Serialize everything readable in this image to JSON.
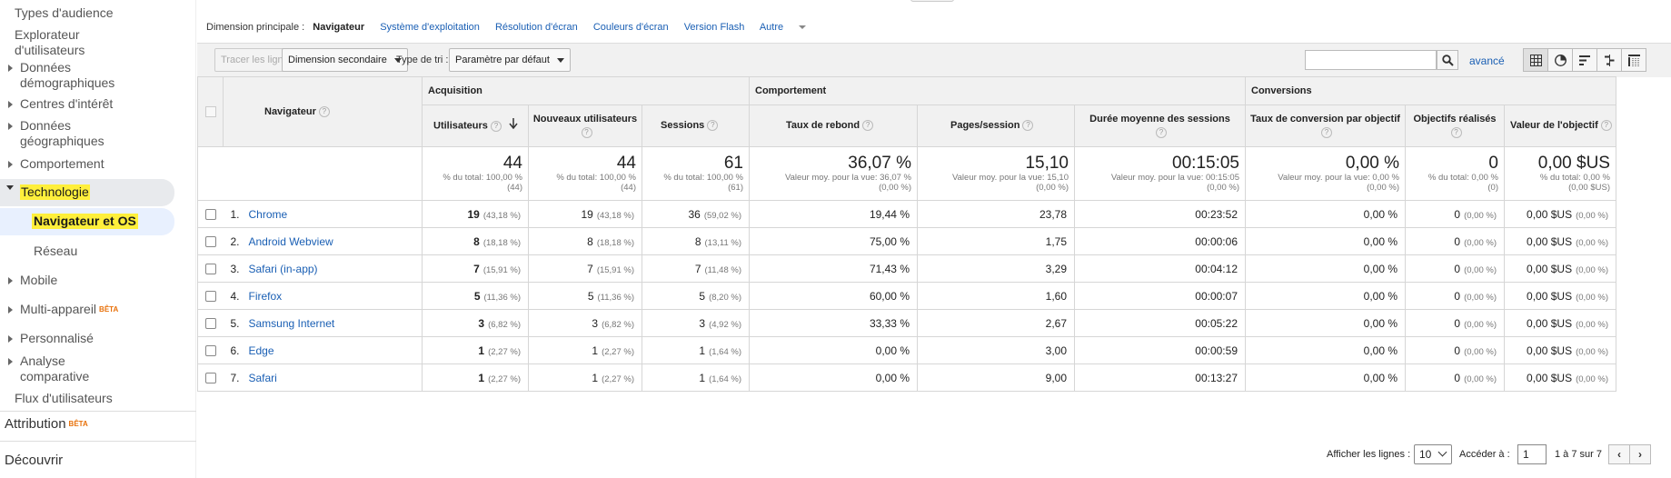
{
  "sidebar": {
    "items": [
      {
        "label": "Types d'audience"
      },
      {
        "label": "Explorateur d'utilisateurs"
      },
      {
        "label": "Données démographiques"
      },
      {
        "label": "Centres d'intérêt"
      },
      {
        "label": "Données géographiques"
      },
      {
        "label": "Comportement"
      },
      {
        "label": "Technologie"
      },
      {
        "label": "Navigateur et OS"
      },
      {
        "label": "Réseau"
      },
      {
        "label": "Mobile"
      },
      {
        "label": "Multi-appareil"
      },
      {
        "label": "Personnalisé"
      },
      {
        "label": "Analyse comparative"
      },
      {
        "label": "Flux d'utilisateurs"
      }
    ],
    "beta_label": "BÊTA",
    "attribution": "Attribution",
    "decouvrir": "Découvrir"
  },
  "dimension_bar": {
    "label": "Dimension principale :",
    "current": "Navigateur",
    "options": [
      "Système d'exploitation",
      "Résolution d'écran",
      "Couleurs d'écran",
      "Version Flash"
    ],
    "other": "Autre"
  },
  "toolbar": {
    "plot_rows": "Tracer les lignes",
    "secondary_dimension": "Dimension secondaire",
    "sort_type_label": "Type de tri :",
    "sort_default": "Paramètre par défaut",
    "advanced": "avancé",
    "search_placeholder": ""
  },
  "table": {
    "group_headers": {
      "acquisition": "Acquisition",
      "comportement": "Comportement",
      "conversions": "Conversions"
    },
    "dimension_header": "Navigateur",
    "columns": [
      "Utilisateurs",
      "Nouveaux utilisateurs",
      "Sessions",
      "Taux de rebond",
      "Pages/session",
      "Durée moyenne des sessions",
      "Taux de conversion par objectif",
      "Objectifs réalisés",
      "Valeur de l'objectif"
    ],
    "totals": [
      {
        "value": "44",
        "note1": "% du total: 100,00 %",
        "note2": "(44)"
      },
      {
        "value": "44",
        "note1": "% du total: 100,00 %",
        "note2": "(44)"
      },
      {
        "value": "61",
        "note1": "% du total: 100,00 %",
        "note2": "(61)"
      },
      {
        "value": "36,07 %",
        "note1": "Valeur moy. pour la vue: 36,07 %",
        "note2": "(0,00 %)"
      },
      {
        "value": "15,10",
        "note1": "Valeur moy. pour la vue: 15,10",
        "note2": "(0,00 %)"
      },
      {
        "value": "00:15:05",
        "note1": "Valeur moy. pour la vue: 00:15:05",
        "note2": "(0,00 %)"
      },
      {
        "value": "0,00 %",
        "note1": "Valeur moy. pour la vue: 0,00 %",
        "note2": "(0,00 %)"
      },
      {
        "value": "0",
        "note1": "% du total: 0,00 %",
        "note2": "(0)"
      },
      {
        "value": "0,00 $US",
        "note1": "% du total: 0,00 %",
        "note2": "(0,00 $US)"
      }
    ],
    "rows": [
      {
        "idx": "1.",
        "name": "Chrome",
        "users": "19",
        "users_pct": "(43,18 %)",
        "new": "19",
        "new_pct": "(43,18 %)",
        "sessions": "36",
        "sessions_pct": "(59,02 %)",
        "bounce": "19,44 %",
        "pages": "23,78",
        "duration": "00:23:52",
        "conv": "0,00 %",
        "goals": "0",
        "goals_pct": "(0,00 %)",
        "value": "0,00 $US",
        "value_pct": "(0,00 %)"
      },
      {
        "idx": "2.",
        "name": "Android Webview",
        "users": "8",
        "users_pct": "(18,18 %)",
        "new": "8",
        "new_pct": "(18,18 %)",
        "sessions": "8",
        "sessions_pct": "(13,11 %)",
        "bounce": "75,00 %",
        "pages": "1,75",
        "duration": "00:00:06",
        "conv": "0,00 %",
        "goals": "0",
        "goals_pct": "(0,00 %)",
        "value": "0,00 $US",
        "value_pct": "(0,00 %)"
      },
      {
        "idx": "3.",
        "name": "Safari (in-app)",
        "users": "7",
        "users_pct": "(15,91 %)",
        "new": "7",
        "new_pct": "(15,91 %)",
        "sessions": "7",
        "sessions_pct": "(11,48 %)",
        "bounce": "71,43 %",
        "pages": "3,29",
        "duration": "00:04:12",
        "conv": "0,00 %",
        "goals": "0",
        "goals_pct": "(0,00 %)",
        "value": "0,00 $US",
        "value_pct": "(0,00 %)"
      },
      {
        "idx": "4.",
        "name": "Firefox",
        "users": "5",
        "users_pct": "(11,36 %)",
        "new": "5",
        "new_pct": "(11,36 %)",
        "sessions": "5",
        "sessions_pct": "(8,20 %)",
        "bounce": "60,00 %",
        "pages": "1,60",
        "duration": "00:00:07",
        "conv": "0,00 %",
        "goals": "0",
        "goals_pct": "(0,00 %)",
        "value": "0,00 $US",
        "value_pct": "(0,00 %)"
      },
      {
        "idx": "5.",
        "name": "Samsung Internet",
        "users": "3",
        "users_pct": "(6,82 %)",
        "new": "3",
        "new_pct": "(6,82 %)",
        "sessions": "3",
        "sessions_pct": "(4,92 %)",
        "bounce": "33,33 %",
        "pages": "2,67",
        "duration": "00:05:22",
        "conv": "0,00 %",
        "goals": "0",
        "goals_pct": "(0,00 %)",
        "value": "0,00 $US",
        "value_pct": "(0,00 %)"
      },
      {
        "idx": "6.",
        "name": "Edge",
        "users": "1",
        "users_pct": "(2,27 %)",
        "new": "1",
        "new_pct": "(2,27 %)",
        "sessions": "1",
        "sessions_pct": "(1,64 %)",
        "bounce": "0,00 %",
        "pages": "3,00",
        "duration": "00:00:59",
        "conv": "0,00 %",
        "goals": "0",
        "goals_pct": "(0,00 %)",
        "value": "0,00 $US",
        "value_pct": "(0,00 %)"
      },
      {
        "idx": "7.",
        "name": "Safari",
        "users": "1",
        "users_pct": "(2,27 %)",
        "new": "1",
        "new_pct": "(2,27 %)",
        "sessions": "1",
        "sessions_pct": "(1,64 %)",
        "bounce": "0,00 %",
        "pages": "9,00",
        "duration": "00:13:27",
        "conv": "0,00 %",
        "goals": "0",
        "goals_pct": "(0,00 %)",
        "value": "0,00 $US",
        "value_pct": "(0,00 %)"
      }
    ]
  },
  "pager": {
    "show_rows_label": "Afficher les lignes :",
    "show_rows_value": "10",
    "goto_label": "Accéder à :",
    "goto_value": "1",
    "range": "1 à 7 sur 7",
    "prev": "‹",
    "next": "›"
  },
  "colors": {
    "link": "#1a5fb4",
    "highlight": "#ffef3b",
    "beta": "#e8710a",
    "header_bg": "#f1f1f1"
  }
}
